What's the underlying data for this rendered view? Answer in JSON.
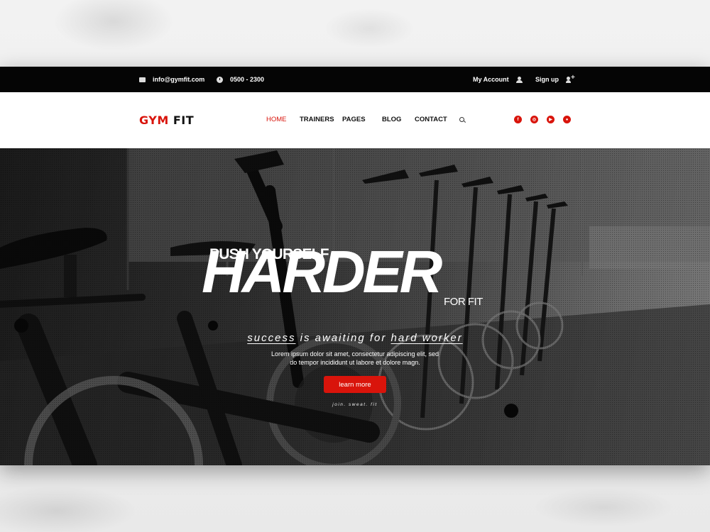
{
  "topbar": {
    "email": "info@gymfit.com",
    "hours": "0500 - 2300",
    "account": "My Account",
    "signup": "Sign up"
  },
  "brand": {
    "part1": "GYM",
    "part2": "FIT",
    "accent_color": "#d9140b"
  },
  "nav": {
    "items": [
      "HOME",
      "TRAINERS",
      "PAGES",
      "BLOG",
      "CONTACT"
    ],
    "active": "HOME"
  },
  "social": [
    "facebook-icon",
    "instagram-icon",
    "youtube-icon",
    "snapchat-icon"
  ],
  "hero": {
    "line1": "PUSH YOURSELF",
    "headline": "HARDER",
    "line3": "FOR FIT",
    "tag_word1": "success",
    "tag_middle": " is awaiting for ",
    "tag_word2": "hard worker",
    "body_line1": "Lorem ipsum dolor sit amet, consectetur adipiscing elit, sed",
    "body_line2": "do tempor incididunt ut labore et dolore magn.",
    "button": "learn more",
    "motto": "join. sweat. fit"
  }
}
